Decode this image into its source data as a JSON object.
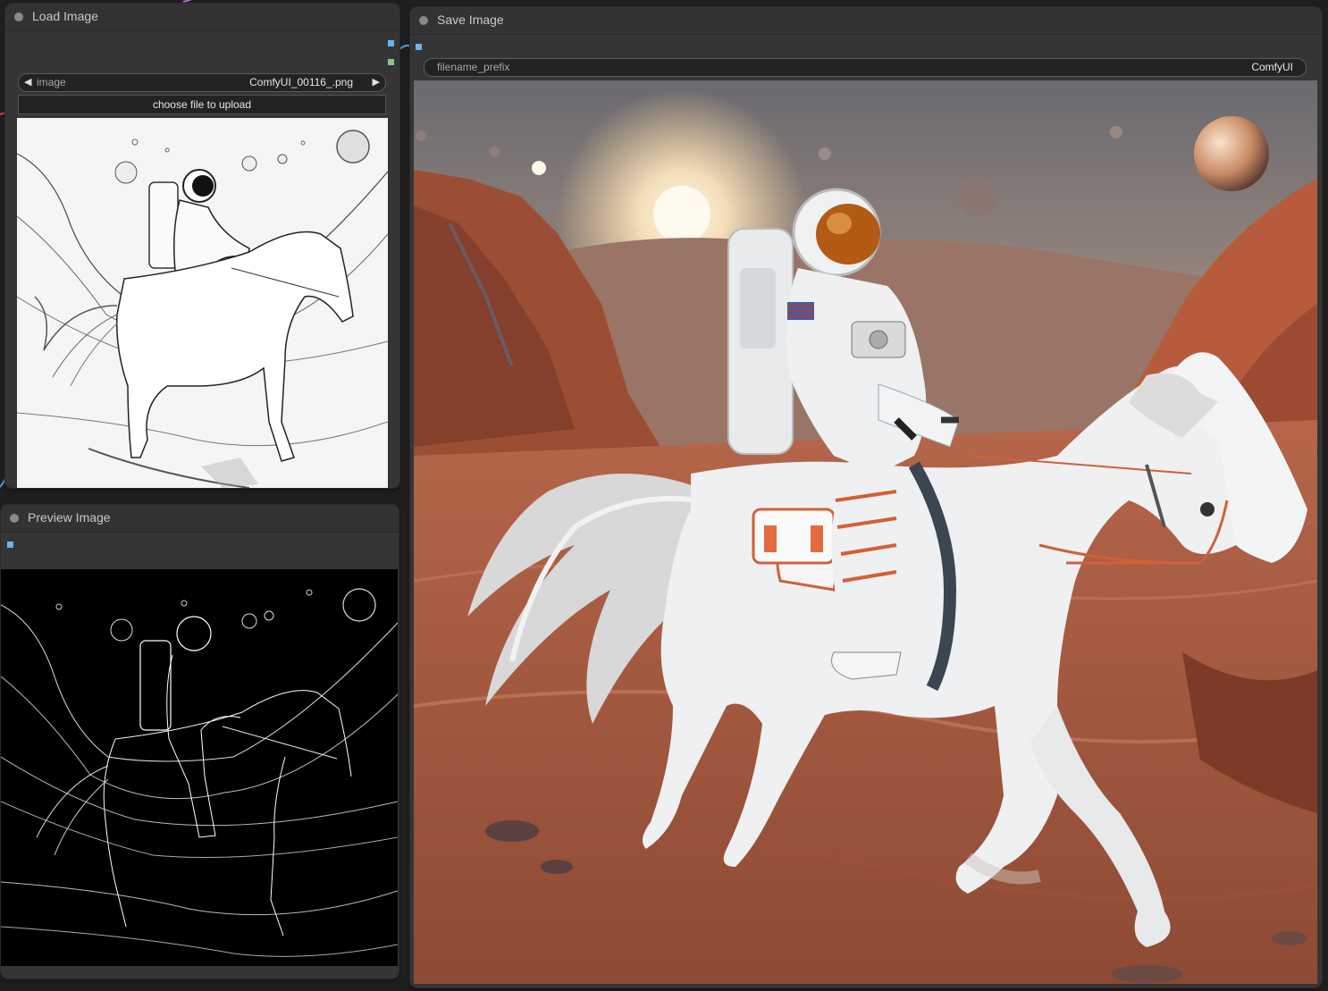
{
  "nodes": {
    "load_image": {
      "title": "Load Image",
      "widget_label": "image",
      "widget_value": "ComfyUI_00116_.png",
      "upload_button": "choose file to upload"
    },
    "preview_image": {
      "title": "Preview Image"
    },
    "save_image": {
      "title": "Save Image",
      "widget_label": "filename_prefix",
      "widget_value": "ComfyUI"
    }
  },
  "colors": {
    "canvas": "#1f1f1f",
    "node_bg": "#353535",
    "slot_image": "#64b5f6",
    "slot_mask": "#81c784",
    "link": "#64b5f6"
  }
}
